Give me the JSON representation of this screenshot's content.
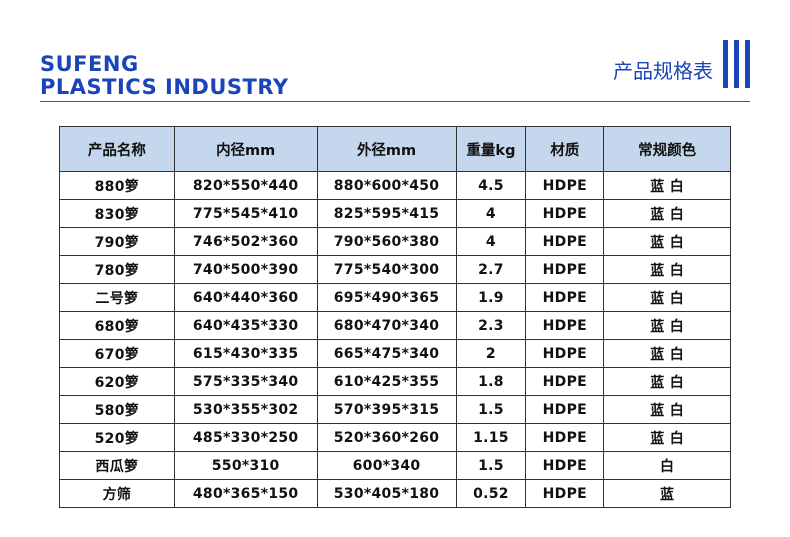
{
  "brand": {
    "line1": "SUFENG",
    "line2": "PLASTICS INDUSTRY"
  },
  "header": {
    "title": "产品规格表"
  },
  "colors": {
    "accent": "#1a44b8",
    "header_bg": "#c5d7ec"
  },
  "table": {
    "columns": [
      "产品名称",
      "内径mm",
      "外径mm",
      "重量kg",
      "材质",
      "常规颜色"
    ],
    "rows": [
      [
        "880箩",
        "820*550*440",
        "880*600*450",
        "4.5",
        "HDPE",
        "蓝 白"
      ],
      [
        "830箩",
        "775*545*410",
        "825*595*415",
        "4",
        "HDPE",
        "蓝 白"
      ],
      [
        "790箩",
        "746*502*360",
        "790*560*380",
        "4",
        "HDPE",
        "蓝 白"
      ],
      [
        "780箩",
        "740*500*390",
        "775*540*300",
        "2.7",
        "HDPE",
        "蓝 白"
      ],
      [
        "二号箩",
        "640*440*360",
        "695*490*365",
        "1.9",
        "HDPE",
        "蓝 白"
      ],
      [
        "680箩",
        "640*435*330",
        "680*470*340",
        "2.3",
        "HDPE",
        "蓝 白"
      ],
      [
        "670箩",
        "615*430*335",
        "665*475*340",
        "2",
        "HDPE",
        "蓝 白"
      ],
      [
        "620箩",
        "575*335*340",
        "610*425*355",
        "1.8",
        "HDPE",
        "蓝 白"
      ],
      [
        "580箩",
        "530*355*302",
        "570*395*315",
        "1.5",
        "HDPE",
        "蓝 白"
      ],
      [
        "520箩",
        "485*330*250",
        "520*360*260",
        "1.15",
        "HDPE",
        "蓝 白"
      ],
      [
        "西瓜箩",
        "550*310",
        "600*340",
        "1.5",
        "HDPE",
        "白"
      ],
      [
        "方筛",
        "480*365*150",
        "530*405*180",
        "0.52",
        "HDPE",
        "蓝"
      ]
    ]
  }
}
